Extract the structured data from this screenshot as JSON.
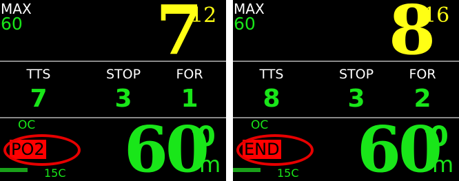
{
  "panels": [
    {
      "max_label": "MAX",
      "max_value": "60",
      "deco_big": "7",
      "deco_small": "12",
      "tts_label": "TTS",
      "tts_value": "7",
      "stop_label": "STOP",
      "stop_value": "3",
      "for_label": "FOR",
      "for_value": "1",
      "oc_label": "OC",
      "badge": "PO2",
      "temp": "15C",
      "depth_int": "60",
      "depth_dec": "0",
      "depth_unit": "m"
    },
    {
      "max_label": "MAX",
      "max_value": "60",
      "deco_big": "8",
      "deco_small": "16",
      "tts_label": "TTS",
      "tts_value": "8",
      "stop_label": "STOP",
      "stop_value": "3",
      "for_label": "FOR",
      "for_value": "2",
      "oc_label": "OC",
      "badge": "END",
      "temp": "15C",
      "depth_int": "60",
      "depth_dec": "0",
      "depth_unit": "m"
    }
  ],
  "colors": {
    "accent_green": "#19e619",
    "deco_yellow": "#ffff14",
    "highlight_red": "#ff0000",
    "background": "#000000"
  }
}
